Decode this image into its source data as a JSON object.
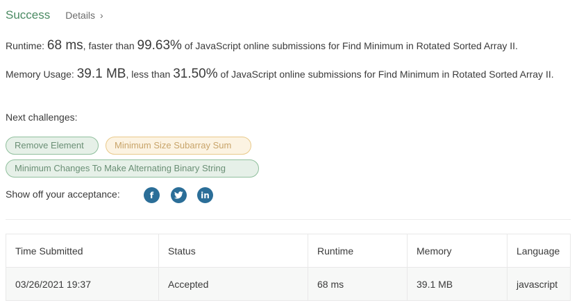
{
  "header": {
    "status": "Success",
    "details_label": "Details",
    "details_chevron": "›"
  },
  "runtime": {
    "label": "Runtime:",
    "value": "68 ms",
    "compare": ", faster than",
    "percent": "99.63%",
    "suffix": "of JavaScript online submissions for Find Minimum in Rotated Sorted Array II."
  },
  "memory": {
    "label": "Memory Usage:",
    "value": "39.1 MB",
    "compare": ", less than",
    "percent": "31.50%",
    "suffix": "of JavaScript online submissions for Find Minimum in Rotated Sorted Array II."
  },
  "next": {
    "label": "Next challenges:",
    "items": [
      {
        "label": "Remove Element",
        "difficulty": "easy"
      },
      {
        "label": "Minimum Size Subarray Sum",
        "difficulty": "medium"
      },
      {
        "label": "Minimum Changes To Make Alternating Binary String",
        "difficulty": "easy"
      }
    ]
  },
  "share": {
    "label": "Show off your acceptance:",
    "icons": [
      "facebook-icon",
      "twitter-icon",
      "linkedin-icon"
    ],
    "facebook_glyph": "f",
    "twitter_glyph": "t",
    "linkedin_glyph": "in"
  },
  "table": {
    "headers": [
      "Time Submitted",
      "Status",
      "Runtime",
      "Memory",
      "Language"
    ],
    "rows": [
      [
        "03/26/2021 19:37",
        "Accepted",
        "68 ms",
        "39.1 MB",
        "javascript"
      ]
    ]
  },
  "colors": {
    "success": "#4a8a62",
    "easy_bg": "#e6f0e8",
    "medium_bg": "#fcf3e2",
    "social": "#2b6e98"
  }
}
